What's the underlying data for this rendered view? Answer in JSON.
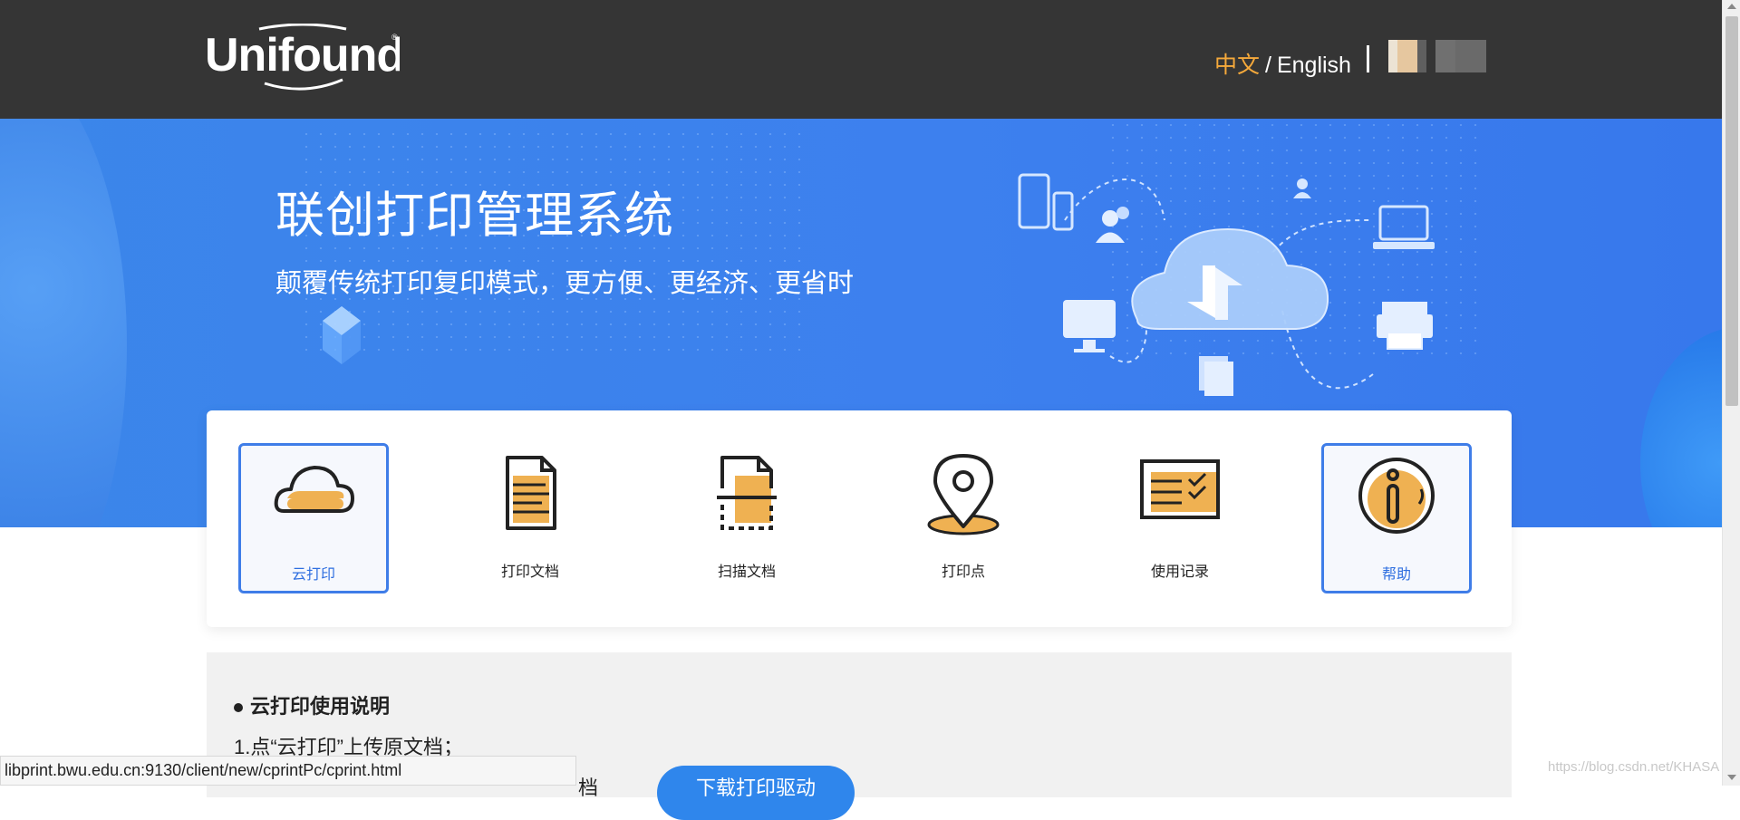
{
  "header": {
    "logo_text": "Unifound",
    "lang_zh": "中文",
    "lang_sep": "/",
    "lang_en": "English",
    "user_avatar": "user-avatar-blurred"
  },
  "banner": {
    "title": "联创打印管理系统",
    "subtitle": "颠覆传统打印复印模式，更方便、更经济、更省时"
  },
  "menu": {
    "items": [
      {
        "label": "云打印",
        "icon": "cloud-icon",
        "active": true
      },
      {
        "label": "打印文档",
        "icon": "document-icon",
        "active": false
      },
      {
        "label": "扫描文档",
        "icon": "scan-icon",
        "active": false
      },
      {
        "label": "打印点",
        "icon": "location-pin-icon",
        "active": false
      },
      {
        "label": "使用记录",
        "icon": "record-icon",
        "active": false
      },
      {
        "label": "帮助",
        "icon": "info-icon",
        "active": true
      }
    ]
  },
  "instructions": {
    "title": "云打印使用说明",
    "step1": "1.点“云打印”上传原文档；",
    "partial_text": "档",
    "download_button": "下载打印驱动"
  },
  "statusbar": {
    "url": "libprint.bwu.edu.cn:9130/client/new/cprintPc/cprint.html"
  },
  "watermark": "https://blog.csdn.net/KHASA",
  "colors": {
    "header_bg": "#353535",
    "banner_blue": "#3d80ee",
    "accent_orange": "#f5a93b",
    "active_border": "#3f7de8"
  }
}
